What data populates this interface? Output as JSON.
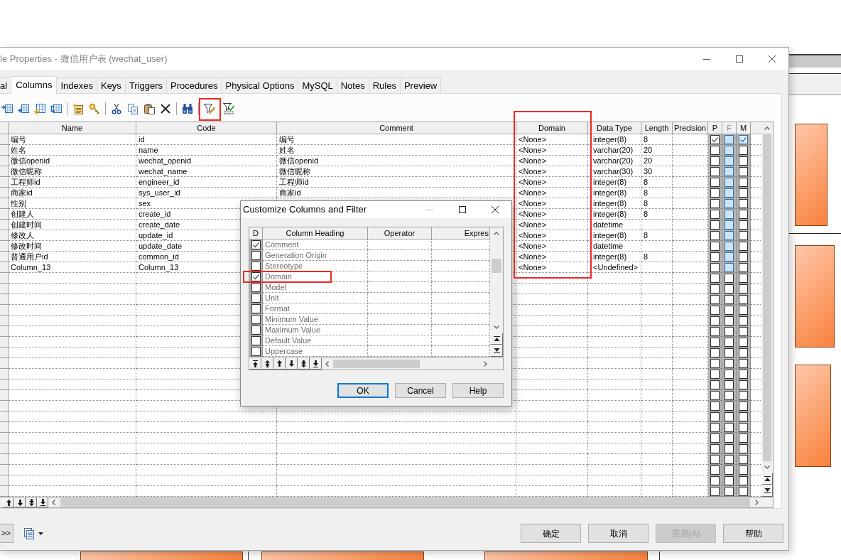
{
  "window": {
    "title": "le Properties - 微信用户表 (wechat_user)"
  },
  "tabs": [
    {
      "label": "al",
      "selected": false
    },
    {
      "label": "Columns",
      "selected": true
    },
    {
      "label": "Indexes",
      "selected": false
    },
    {
      "label": "Keys",
      "selected": false
    },
    {
      "label": "Triggers",
      "selected": false
    },
    {
      "label": "Procedures",
      "selected": false
    },
    {
      "label": "Physical Options",
      "selected": false
    },
    {
      "label": "MySQL",
      "selected": false
    },
    {
      "label": "Notes",
      "selected": false
    },
    {
      "label": "Rules",
      "selected": false
    },
    {
      "label": "Preview",
      "selected": false
    }
  ],
  "toolbar_highlight": true,
  "columns": [
    {
      "label": "Name",
      "kind": "text",
      "highlighted": false,
      "disabled": false
    },
    {
      "label": "Code",
      "kind": "text",
      "highlighted": false,
      "disabled": false
    },
    {
      "label": "Comment",
      "kind": "text",
      "highlighted": false,
      "disabled": false
    },
    {
      "label": "Domain",
      "kind": "text",
      "highlighted": true,
      "disabled": false
    },
    {
      "label": "Data Type",
      "kind": "text",
      "highlighted": false,
      "disabled": false
    },
    {
      "label": "Length",
      "kind": "text",
      "highlighted": false,
      "disabled": false
    },
    {
      "label": "Precision",
      "kind": "text",
      "highlighted": false,
      "disabled": false
    },
    {
      "label": "P",
      "kind": "check",
      "highlighted": false,
      "disabled": false
    },
    {
      "label": "F",
      "kind": "check",
      "highlighted": false,
      "disabled": true
    },
    {
      "label": "M",
      "kind": "check",
      "highlighted": false,
      "disabled": false
    }
  ],
  "rows": [
    {
      "kind": "column",
      "name": "编号",
      "code": "id",
      "comment": "编号",
      "domain": "<None>",
      "data_type": "integer(8)",
      "length": "8",
      "p": true,
      "f": false,
      "m": true
    },
    {
      "kind": "column",
      "name": "姓名",
      "code": "name",
      "comment": "姓名",
      "domain": "<None>",
      "data_type": "varchar(20)",
      "length": "20",
      "p": false,
      "f": false,
      "m": false
    },
    {
      "kind": "column",
      "name": "微信openid",
      "code": "wechat_openid",
      "comment": "微信openid",
      "domain": "<None>",
      "data_type": "varchar(20)",
      "length": "20",
      "p": false,
      "f": false,
      "m": false
    },
    {
      "kind": "column",
      "name": "微信昵称",
      "code": "wechat_name",
      "comment": "微信昵称",
      "domain": "<None>",
      "data_type": "varchar(30)",
      "length": "30",
      "p": false,
      "f": false,
      "m": false
    },
    {
      "kind": "column",
      "name": "工程师id",
      "code": "engineer_id",
      "comment": "工程师id",
      "domain": "<None>",
      "data_type": "integer(8)",
      "length": "8",
      "p": false,
      "f": false,
      "m": false
    },
    {
      "kind": "column",
      "name": "商家id",
      "code": "sys_user_id",
      "comment": "商家id",
      "domain": "<None>",
      "data_type": "integer(8)",
      "length": "8",
      "p": false,
      "f": false,
      "m": false
    },
    {
      "kind": "column",
      "name": "性别",
      "code": "sex",
      "domain": "<None>",
      "data_type": "integer(8)",
      "length": "8",
      "p": false,
      "f": false,
      "m": false
    },
    {
      "kind": "column",
      "name": "创建人",
      "code": "create_id",
      "domain": "<None>",
      "data_type": "integer(8)",
      "length": "8",
      "p": false,
      "f": false,
      "m": false
    },
    {
      "kind": "column",
      "name": "创建时间",
      "code": "create_date",
      "domain": "<None>",
      "data_type": "datetime",
      "p": false,
      "f": false,
      "m": false
    },
    {
      "kind": "column",
      "name": "修改人",
      "code": "update_id",
      "domain": "<None>",
      "data_type": "integer(8)",
      "length": "8",
      "p": false,
      "f": false,
      "m": false
    },
    {
      "kind": "column",
      "name": "修改时间",
      "code": "update_date",
      "domain": "<None>",
      "data_type": "datetime",
      "p": false,
      "f": false,
      "m": false
    },
    {
      "kind": "column",
      "name": "普通用户id",
      "code": "common_id",
      "domain": "<None>",
      "data_type": "integer(8)",
      "length": "8",
      "p": false,
      "f": false,
      "m": false
    },
    {
      "kind": "column",
      "name": "Column_13",
      "code": "Column_13",
      "domain": "<None>",
      "data_type": "<Undefined>",
      "p": false,
      "f": false,
      "m": false
    },
    {
      "kind": "placeholder",
      "p": false,
      "f": false,
      "m": false
    },
    {
      "kind": "placeholder",
      "p": false,
      "f": false,
      "m": false
    },
    {
      "kind": "placeholder",
      "p": false,
      "f": false,
      "m": false
    },
    {
      "kind": "placeholder",
      "p": false,
      "f": false,
      "m": false
    },
    {
      "kind": "placeholder",
      "p": false,
      "f": false,
      "m": false
    },
    {
      "kind": "placeholder",
      "p": false,
      "f": false,
      "m": false
    },
    {
      "kind": "placeholder",
      "p": false,
      "f": false,
      "m": false
    },
    {
      "kind": "placeholder",
      "p": false,
      "f": false,
      "m": false
    },
    {
      "kind": "placeholder",
      "p": false,
      "f": false,
      "m": false
    },
    {
      "kind": "placeholder",
      "p": false,
      "f": false,
      "m": false
    },
    {
      "kind": "placeholder",
      "p": false,
      "f": false,
      "m": false
    },
    {
      "kind": "placeholder",
      "p": false,
      "f": false,
      "m": false
    },
    {
      "kind": "placeholder",
      "p": false,
      "f": false,
      "m": false
    },
    {
      "kind": "placeholder",
      "p": false,
      "f": false,
      "m": false
    },
    {
      "kind": "placeholder",
      "p": false,
      "f": false,
      "m": false
    },
    {
      "kind": "placeholder",
      "p": false,
      "f": false,
      "m": false
    },
    {
      "kind": "placeholder",
      "p": false,
      "f": false,
      "m": false
    },
    {
      "kind": "placeholder",
      "p": false,
      "f": false,
      "m": false
    },
    {
      "kind": "placeholder",
      "p": false,
      "f": false,
      "m": false
    },
    {
      "kind": "placeholder",
      "p": false,
      "f": false,
      "m": false
    },
    {
      "kind": "placeholder",
      "p": false,
      "f": false,
      "m": false
    }
  ],
  "dialog": {
    "title": "Customize Columns and Filter",
    "columns": [
      "D",
      "Column Heading",
      "Operator",
      "Expres"
    ],
    "rows": [
      {
        "label": "Comment",
        "checked": true,
        "highlighted": false
      },
      {
        "label": "Generation Origin",
        "checked": false,
        "highlighted": false
      },
      {
        "label": "Stereotype",
        "checked": false,
        "highlighted": false
      },
      {
        "label": "Domain",
        "checked": true,
        "highlighted": true
      },
      {
        "label": "Model",
        "checked": false,
        "highlighted": false
      },
      {
        "label": "Unit",
        "checked": false,
        "highlighted": false
      },
      {
        "label": "Format",
        "checked": false,
        "highlighted": false
      },
      {
        "label": "Minimum Value",
        "checked": false,
        "highlighted": false
      },
      {
        "label": "Maximum Value",
        "checked": false,
        "highlighted": false
      },
      {
        "label": "Default Value",
        "checked": false,
        "highlighted": false
      },
      {
        "label": "Uppercase",
        "checked": false,
        "highlighted": false
      }
    ],
    "buttons": [
      {
        "label": "OK",
        "focused": true
      },
      {
        "label": "Cancel",
        "focused": false
      },
      {
        "label": "Help",
        "focused": false
      }
    ]
  },
  "footer": {
    "expand_label": ">>",
    "buttons": [
      {
        "label": "确定",
        "disabled": false
      },
      {
        "label": "取消",
        "disabled": false
      },
      {
        "label": "应用(A)",
        "disabled": true
      },
      {
        "label": "帮助",
        "disabled": false
      }
    ]
  }
}
